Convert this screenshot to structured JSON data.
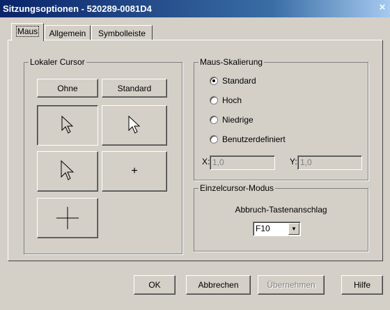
{
  "window": {
    "title": "Sitzungsoptionen - 520289-0081D4",
    "close_glyph": "×"
  },
  "tabs": [
    {
      "label": "Maus",
      "active": true
    },
    {
      "label": "Allgemein",
      "active": false
    },
    {
      "label": "Symbolleiste",
      "active": false
    }
  ],
  "local_cursor": {
    "legend": "Lokaler Cursor",
    "ohne_label": "Ohne",
    "standard_label": "Standard",
    "cursor_options": [
      "arrow-outline",
      "arrow-white",
      "arrow-outline-large",
      "small-crosshair",
      "large-crosshair"
    ],
    "small_plus": "+"
  },
  "mouse_scaling": {
    "legend": "Maus-Skalierung",
    "options": [
      {
        "label": "Standard",
        "selected": true
      },
      {
        "label": "Hoch",
        "selected": false
      },
      {
        "label": "Niedrige",
        "selected": false
      },
      {
        "label": "Benutzerdefiniert",
        "selected": false
      }
    ],
    "x_label": "X:",
    "x_value": "1,0",
    "y_label": "Y:",
    "y_value": "1,0"
  },
  "single_cursor": {
    "legend": "Einzelcursor-Modus",
    "abort_label": "Abbruch-Tastenanschlag",
    "key_value": "F10",
    "dropdown_glyph": "▼"
  },
  "buttons": {
    "ok": "OK",
    "cancel": "Abbrechen",
    "apply": "Übernehmen",
    "help": "Hilfe"
  }
}
